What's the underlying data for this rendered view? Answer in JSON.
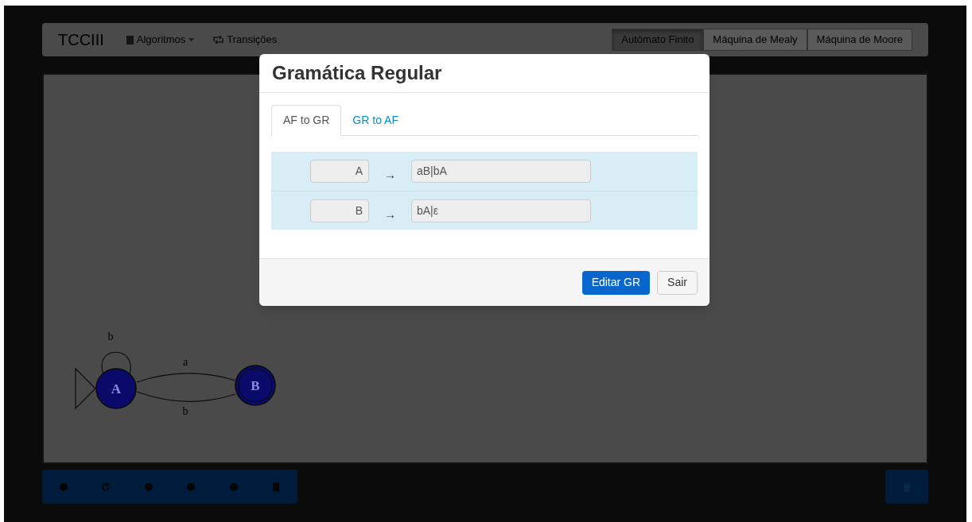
{
  "navbar": {
    "brand": "TCCIII",
    "menu": [
      {
        "label": "Algoritmos",
        "kind": "dropdown"
      },
      {
        "label": "Transições",
        "kind": "link"
      }
    ],
    "modes": [
      {
        "label": "Autómato Finito",
        "selected": true
      },
      {
        "label": "Máquina de Mealy",
        "selected": false
      },
      {
        "label": "Máquina de Moore",
        "selected": false
      }
    ]
  },
  "automaton": {
    "states": [
      {
        "label": "A",
        "initial": true,
        "final": false
      },
      {
        "label": "B",
        "initial": false,
        "final": true
      }
    ],
    "transitions": [
      {
        "label": "b",
        "kind": "loop"
      },
      {
        "label": "a",
        "kind": "forward"
      },
      {
        "label": "b",
        "kind": "backward"
      }
    ]
  },
  "modal": {
    "title": "Gramática Regular",
    "tabs": [
      {
        "label": "AF to GR",
        "selected": true
      },
      {
        "label": "GR to AF",
        "selected": false
      }
    ],
    "rules": [
      {
        "left": "A",
        "arrow": "→",
        "right": "aB|bA"
      },
      {
        "left": "B",
        "arrow": "→",
        "right": "bA|ε"
      }
    ],
    "buttons": [
      {
        "label": "Editar GR",
        "kind": "primary"
      },
      {
        "label": "Sair",
        "kind": "default"
      }
    ]
  }
}
